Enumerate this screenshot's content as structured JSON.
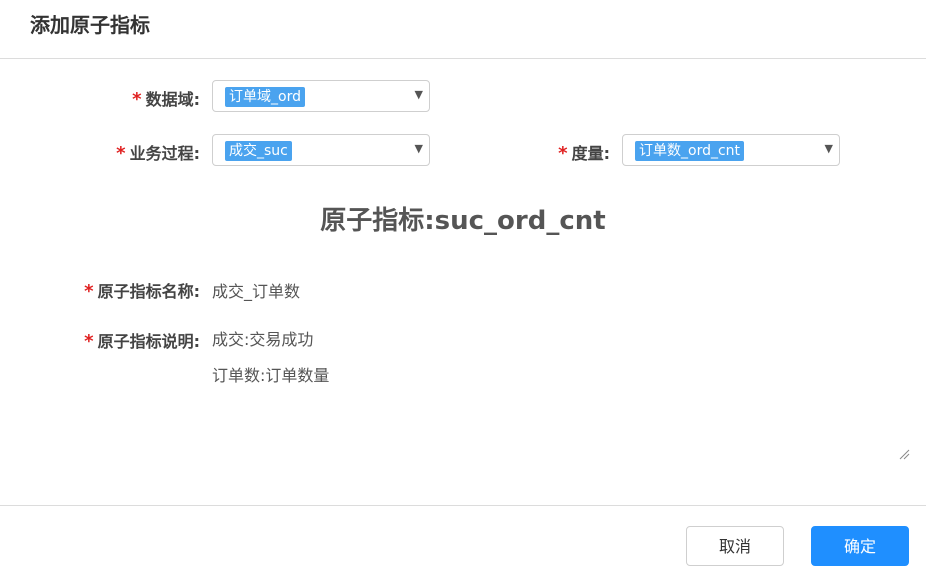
{
  "dialog": {
    "title": "添加原子指标"
  },
  "form": {
    "domain": {
      "label": "数据域:",
      "value": "订单域_ord"
    },
    "process": {
      "label": "业务过程:",
      "value": "成交_suc"
    },
    "measure": {
      "label": "度量:",
      "value": "订单数_ord_cnt"
    },
    "required_mark": "*",
    "caret": "▼"
  },
  "metric": {
    "heading": "原子指标:suc_ord_cnt",
    "name_label": "原子指标名称:",
    "name_value": "成交_订单数",
    "desc_label": "原子指标说明:",
    "desc_line1": "成交:交易成功",
    "desc_line2": "订单数:订单数量"
  },
  "footer": {
    "cancel_label": "取消",
    "ok_label": "确定"
  },
  "colors": {
    "tag": "#4aa3ef",
    "primary": "#1f8fff",
    "required": "#e02020"
  }
}
